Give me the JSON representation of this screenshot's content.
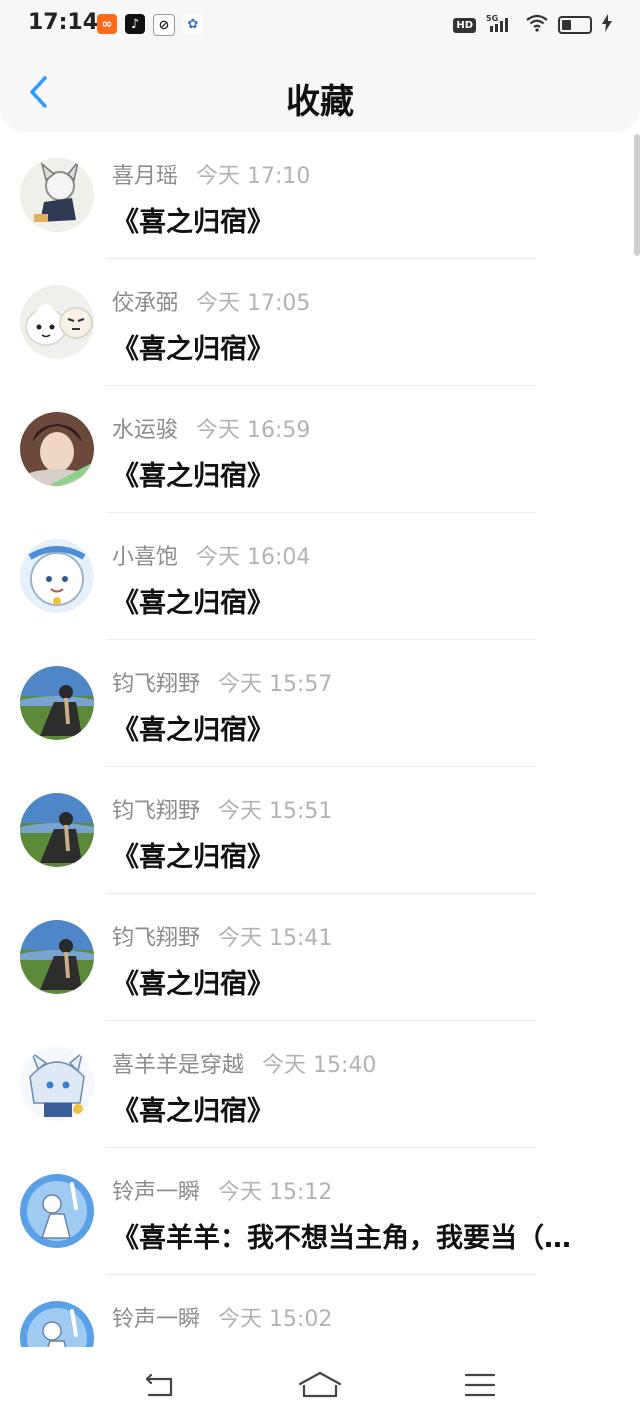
{
  "status_bar": {
    "time": "17:14",
    "network": "5G",
    "hd": "HD"
  },
  "header": {
    "title": "收藏",
    "back_icon": "chevron-left-icon"
  },
  "favorites": [
    {
      "author": "喜月瑶",
      "time": "今天 17:10",
      "title": "《喜之归宿》"
    },
    {
      "author": "佼承弼",
      "time": "今天 17:05",
      "title": "《喜之归宿》"
    },
    {
      "author": "水运骏",
      "time": "今天 16:59",
      "title": "《喜之归宿》"
    },
    {
      "author": "小喜饱",
      "time": "今天 16:04",
      "title": "《喜之归宿》"
    },
    {
      "author": "钧飞翔野",
      "time": "今天 15:57",
      "title": "《喜之归宿》"
    },
    {
      "author": "钧飞翔野",
      "time": "今天 15:51",
      "title": "《喜之归宿》"
    },
    {
      "author": "钧飞翔野",
      "time": "今天 15:41",
      "title": "《喜之归宿》"
    },
    {
      "author": "喜羊羊是穿越",
      "time": "今天 15:40",
      "title": "《喜之归宿》"
    },
    {
      "author": "铃声一瞬",
      "time": "今天 15:12",
      "title": "《喜羊羊：我不想当主角，我要当（…"
    },
    {
      "author": "铃声一瞬",
      "time": "今天 15:02",
      "title": ""
    }
  ],
  "colors": {
    "accent": "#2f9bff",
    "title_text": "#111111",
    "meta_text": "#8c8c8c"
  },
  "nav": {
    "back_icon": "back-icon",
    "home_icon": "home-icon",
    "menu_icon": "menu-icon"
  }
}
